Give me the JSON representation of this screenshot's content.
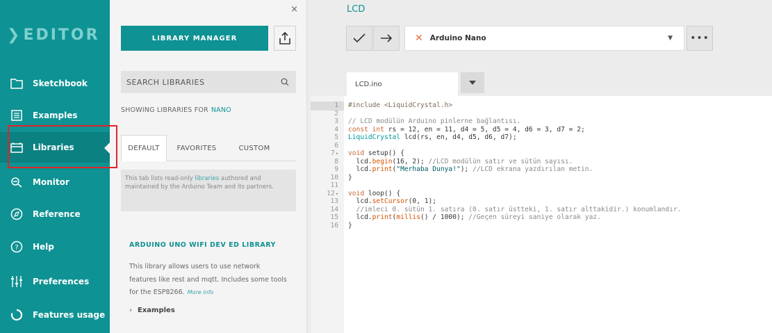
{
  "nav": {
    "logo": "EDITOR",
    "items": [
      {
        "label": "Sketchbook",
        "icon": "folder-icon"
      },
      {
        "label": "Examples",
        "icon": "list-icon"
      },
      {
        "label": "Libraries",
        "icon": "books-icon"
      },
      {
        "label": "Monitor",
        "icon": "monitor-search-icon"
      },
      {
        "label": "Reference",
        "icon": "compass-icon"
      },
      {
        "label": "Help",
        "icon": "help-icon"
      },
      {
        "label": "Preferences",
        "icon": "sliders-icon"
      },
      {
        "label": "Features usage",
        "icon": "ring-icon"
      }
    ],
    "active_item": "Libraries",
    "highlight_color": "#e0242a"
  },
  "library_panel": {
    "close": "×",
    "manager_button": "LIBRARY MANAGER",
    "search_placeholder": "SEARCH LIBRARIES",
    "showing_prefix": "SHOWING LIBRARIES FOR",
    "board": "NANO",
    "tabs": [
      "DEFAULT",
      "FAVORITES",
      "CUSTOM"
    ],
    "active_tab": "DEFAULT",
    "notice_pre": "This tab lists read-only ",
    "notice_link": "libraries",
    "notice_post": " authored and maintained by the Arduino Team and its partners.",
    "item": {
      "title": "ARDUINO UNO WIFI DEV ED LIBRARY",
      "description": "This library allows users to use network features like rest and mqtt. Includes some tools for the ESP8266.",
      "more_info": "More info",
      "examples": "Examples"
    }
  },
  "editor": {
    "sketch_name": "LCD",
    "board_name": "Arduino Nano",
    "more": "•••",
    "file_tab": "LCD.ino",
    "line_numbers": [
      "1",
      "2",
      "3",
      "4",
      "5",
      "6",
      "7",
      "8",
      "9",
      "10",
      "11",
      "12",
      "13",
      "14",
      "15",
      "16"
    ],
    "code": {
      "l1": "#include <LiquidCrystal.h>",
      "l3": "// LCD modülün Arduino pinlerne bağlantısı.",
      "l4_kw": "const int",
      "l4_rest": " rs = 12, en = 11, d4 = 5, d5 = 4, d6 = 3, d7 = 2;",
      "l5_ty": "LiquidCrystal",
      "l5_rest": " lcd(rs, en, d4, d5, d6, d7);",
      "l7_kw": "void",
      "l7_fn": " setup",
      "l7_rest": "() {",
      "l8_a": "  lcd.",
      "l8_fn": "begin",
      "l8_b": "(16, 2); ",
      "l8_cm": "//LCD modülün satır ve sütün sayısı.",
      "l9_a": "  lcd.",
      "l9_fn": "print",
      "l9_b": "(",
      "l9_str": "\"Merhaba Dunya!\"",
      "l9_c": "); ",
      "l9_cm": "//LCD ekrana yazdırılan metin.",
      "l10": "}",
      "l12_kw": "void",
      "l12_fn": " loop",
      "l12_rest": "() {",
      "l13_a": "  lcd.",
      "l13_fn": "setCursor",
      "l13_b": "(0, 1);",
      "l14_cm": "  //imleci 0. sütün 1. satıra (0. satır üstteki, 1. satır alttakidir.) konumlandır.",
      "l15_a": "  lcd.",
      "l15_fn": "print",
      "l15_b": "(",
      "l15_fn2": "millis",
      "l15_c": "() / 1000); ",
      "l15_cm": "//Geçen süreyi saniye olarak yaz.",
      "l16": "}"
    }
  }
}
